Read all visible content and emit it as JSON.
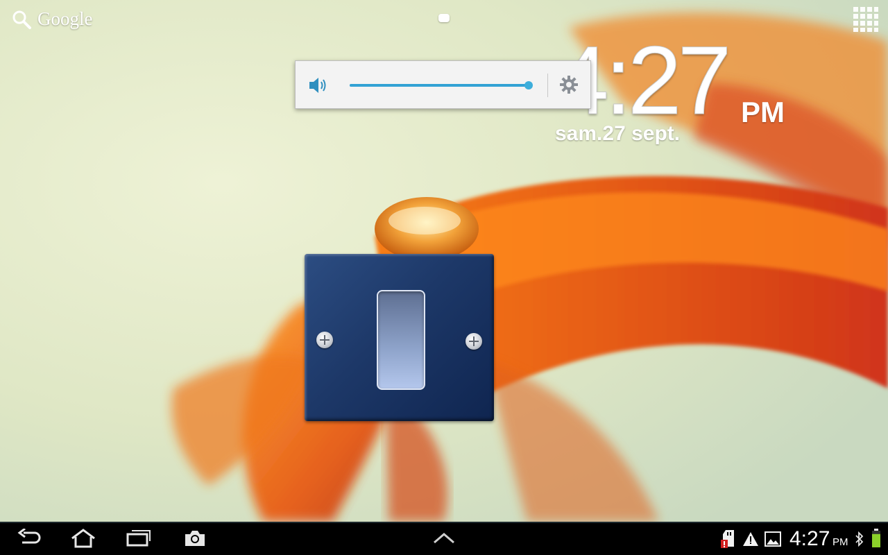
{
  "home": {
    "search_label": "Google",
    "clock": {
      "time": "4:27",
      "ampm": "PM",
      "date": "sam.27 sept."
    }
  },
  "volume": {
    "level": 1.0
  },
  "light_switch": {
    "state": "on"
  },
  "statusbar": {
    "time": "4:27",
    "ampm": "PM",
    "battery_level": 0.8
  },
  "colors": {
    "accent": "#33a2d4",
    "navbar": "#000000"
  }
}
